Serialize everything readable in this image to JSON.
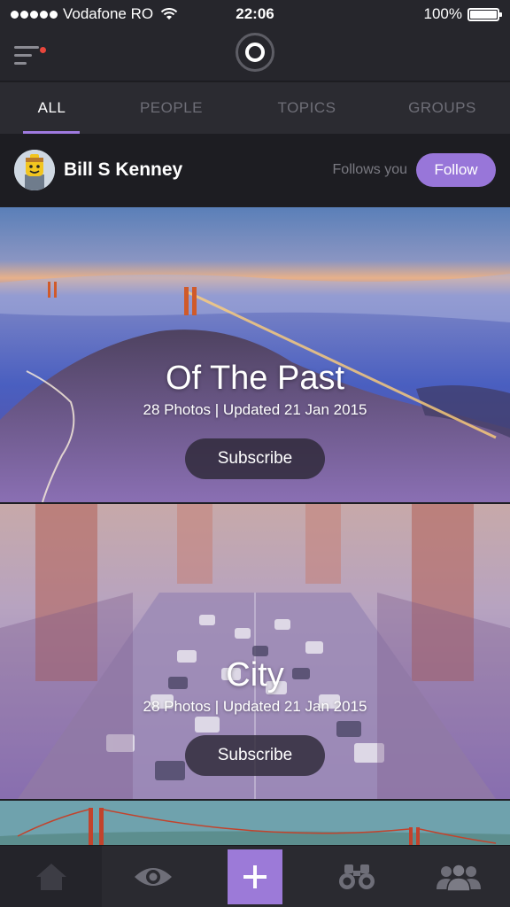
{
  "status_bar": {
    "carrier": "Vodafone RO",
    "time": "22:06",
    "battery": "100%",
    "battery_level": 1.0
  },
  "nav": {
    "menu_icon": "hamburger-menu-icon",
    "logo_icon": "ring-logo-icon"
  },
  "tabs": [
    {
      "label": "ALL",
      "active": true
    },
    {
      "label": "PEOPLE",
      "active": false
    },
    {
      "label": "TOPICS",
      "active": false
    },
    {
      "label": "GROUPS",
      "active": false
    }
  ],
  "user": {
    "name": "Bill S Kenney",
    "follows_text": "Follows you",
    "follow_label": "Follow"
  },
  "cards": [
    {
      "title": "Of The Past",
      "meta": "28 Photos | Updated 21 Jan 2015",
      "subscribe_label": "Subscribe"
    },
    {
      "title": "City",
      "meta": "28 Photos | Updated 21 Jan 2015",
      "subscribe_label": "Subscribe"
    }
  ],
  "tabbar": [
    {
      "icon": "home-icon"
    },
    {
      "icon": "eye-icon"
    },
    {
      "icon": "plus-icon"
    },
    {
      "icon": "binoculars-icon"
    },
    {
      "icon": "group-icon"
    }
  ],
  "colors": {
    "accent": "#9876d9",
    "background": "#1f1f24"
  }
}
